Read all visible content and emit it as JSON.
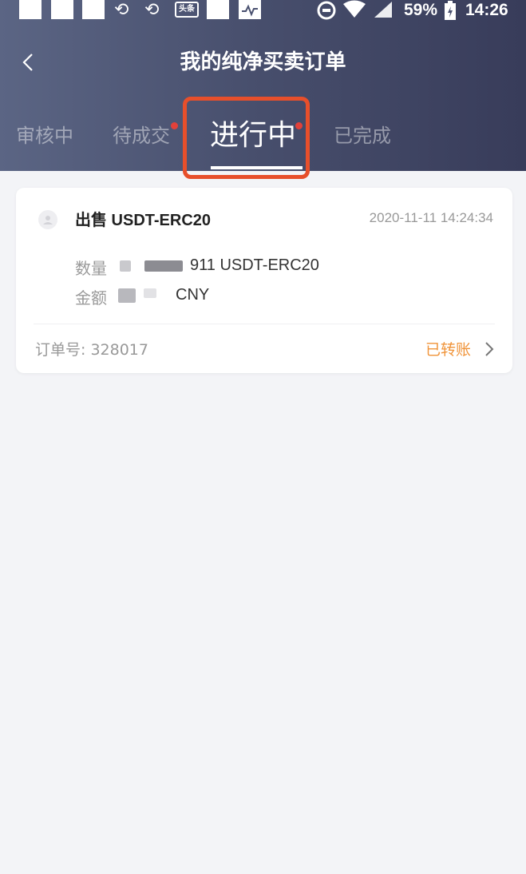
{
  "status_bar": {
    "battery": "59%",
    "time": "14:26",
    "news_icon_label": "头条"
  },
  "header": {
    "title": "我的纯净买卖订单",
    "back_icon": "chevron-left-icon"
  },
  "tabs": [
    {
      "label": "审核中",
      "dot": false,
      "active": false
    },
    {
      "label": "待成交",
      "dot": true,
      "active": false
    },
    {
      "label": "进行中",
      "dot": true,
      "active": true
    },
    {
      "label": "已完成",
      "dot": false,
      "active": false
    }
  ],
  "order": {
    "title": "出售 USDT-ERC20",
    "time": "2020-11-11 14:24:34",
    "qty_label": "数量",
    "qty_value": "911 USDT-ERC20",
    "amount_label": "金额",
    "amount_value": "CNY",
    "order_no": "订单号:  328017",
    "status": "已转账"
  },
  "colors": {
    "accent_orange": "#f0943a",
    "highlight_red": "#e74f2b",
    "dot_red": "#e2413a"
  }
}
